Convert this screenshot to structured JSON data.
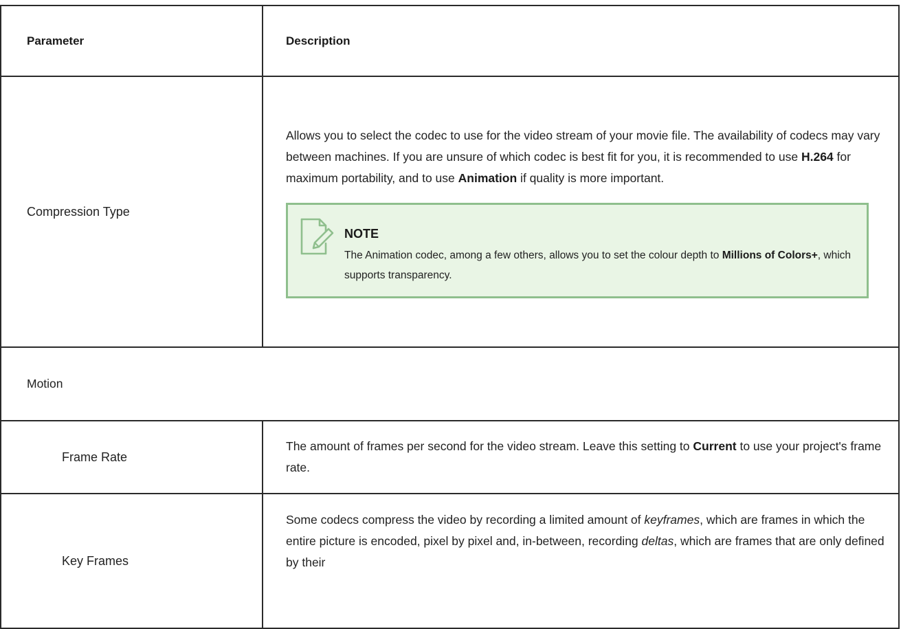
{
  "table": {
    "header": {
      "parameter": "Parameter",
      "description": "Description"
    },
    "compression": {
      "label": "Compression Type",
      "p1": "Allows you to select the codec to use for the video stream of your movie file. The availability of codecs may vary between machines. If you are unsure of which codec is best fit for you, it is recommended to use ",
      "h264": "H.264",
      "p2": " for maximum portability, and to use ",
      "animation": "Animation",
      "p3": " if quality is more important.",
      "note": {
        "icon": "note-pencil-icon",
        "title": "NOTE",
        "t1": "The Animation codec, among a few others, allows you to set the colour depth to ",
        "bold": "Millions of Colors+",
        "t2": ", which supports transparency."
      }
    },
    "motion": {
      "label": "Motion"
    },
    "framerate": {
      "label": "Frame Rate",
      "p1": "The amount of frames per second for the video stream. Leave this setting to ",
      "current": "Current",
      "p2": " to use your project's frame rate."
    },
    "keyframes": {
      "label": "Key Frames",
      "p1": "Some codecs compress the video by recording a limited amount of ",
      "em1": "keyframes",
      "p2": ", which are frames in which the entire picture is encoded, pixel by pixel and, in-between, recording ",
      "em2": "deltas",
      "p3": ", which are frames that are only defined by their"
    }
  },
  "colors": {
    "border": "#2a2a2a",
    "note_background": "#e9f5e5",
    "note_border": "#8fbf8d"
  }
}
